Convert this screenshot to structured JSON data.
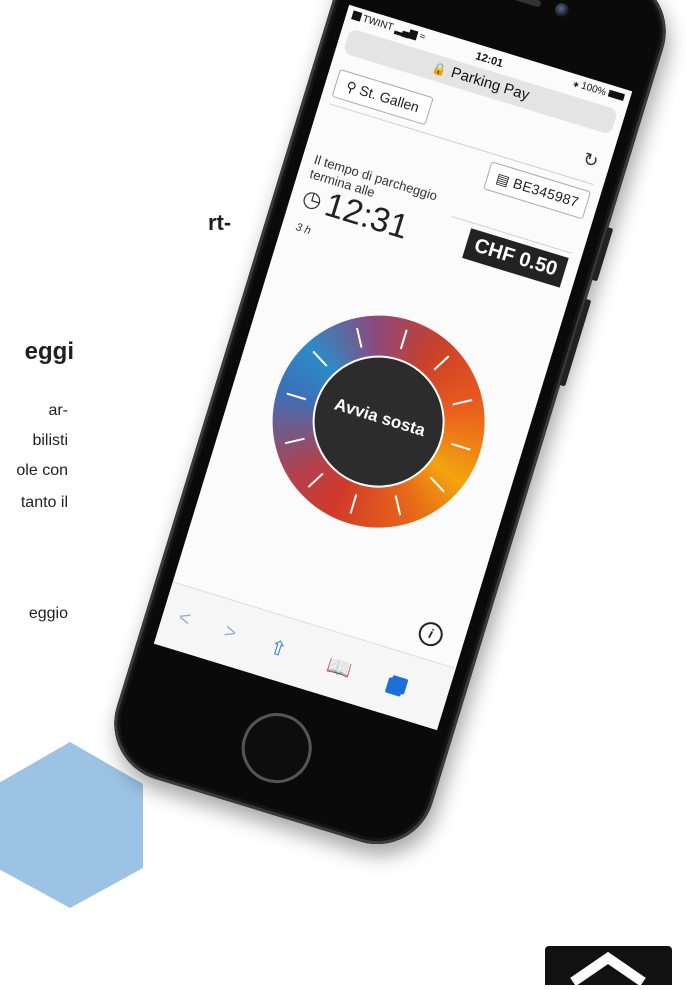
{
  "page": {
    "heading_fragment_1": "rt-",
    "heading_fragment_2": "eggi",
    "para_lines": [
      "ar-",
      "bilisti",
      "ole con",
      "tanto il"
    ],
    "para_line_last": "eggio"
  },
  "status_bar": {
    "carrier": "TWINT",
    "time": "12:01",
    "battery": "100%"
  },
  "url_bar": {
    "title": "Parking Pay"
  },
  "parking": {
    "location": "St. Gallen",
    "plate": "BE345987",
    "end_label": "Il tempo di parcheggio termina alle",
    "end_time": "12:31",
    "duration": "3 h",
    "price": "CHF 0.50",
    "dial_button": "Avvia sosta"
  },
  "toolbar": {
    "back": "<",
    "forward": ">",
    "info": "i"
  },
  "colors": {
    "dial_blue": "#2b8cc8",
    "dial_red": "#d13a2a",
    "dial_orange": "#f3a40e",
    "accent_blue": "#1d6fd8",
    "hex_blue": "#9dc3e4"
  }
}
